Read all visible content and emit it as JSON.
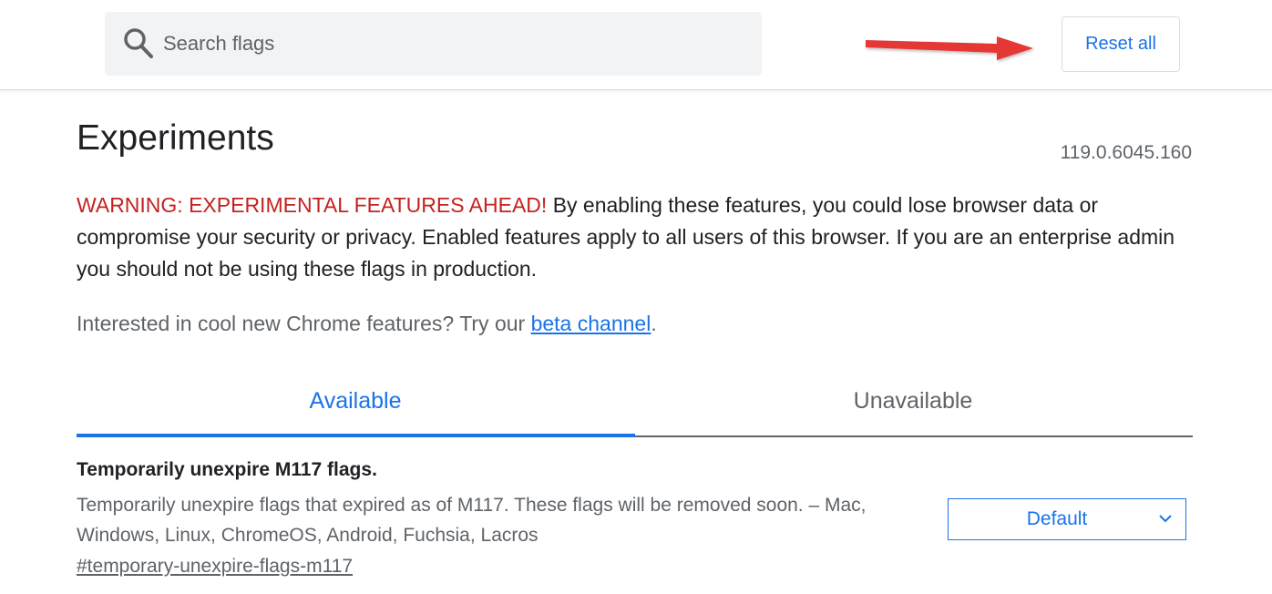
{
  "search": {
    "placeholder": "Search flags",
    "value": ""
  },
  "header": {
    "reset_label": "Reset all",
    "annotation": "red-arrow"
  },
  "page": {
    "title": "Experiments",
    "version": "119.0.6045.160",
    "warning_label": "WARNING: EXPERIMENTAL FEATURES AHEAD!",
    "warning_text": " By enabling these features, you could lose browser data or compromise your security or privacy. Enabled features apply to all users of this browser. If you are an enterprise admin you should not be using these flags in production.",
    "promo_text": "Interested in cool new Chrome features? Try our ",
    "promo_link": "beta channel",
    "promo_end": "."
  },
  "tabs": [
    {
      "label": "Available",
      "selected": true
    },
    {
      "label": "Unavailable",
      "selected": false
    }
  ],
  "flags": [
    {
      "title": "Temporarily unexpire M117 flags.",
      "description": "Temporarily unexpire flags that expired as of M117. These flags will be removed soon. – Mac, Windows, Linux, ChromeOS, Android, Fuchsia, Lacros",
      "link": "#temporary-unexpire-flags-m117",
      "selected_option": "Default"
    }
  ],
  "colors": {
    "accent": "#1a73e8",
    "warning": "#c5221f",
    "arrow": "#e53935"
  }
}
